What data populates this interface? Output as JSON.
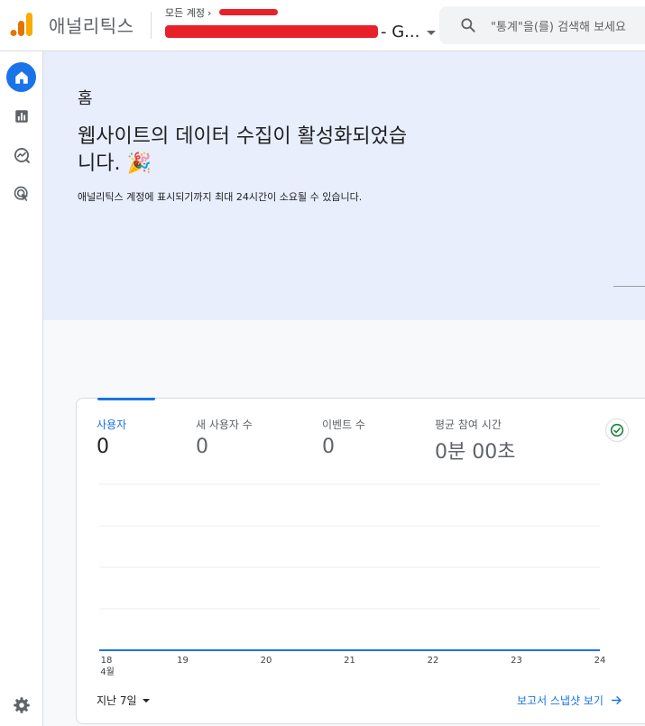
{
  "header": {
    "app_title": "애널리틱스",
    "breadcrumb_label": "모든 계정",
    "property_suffix": "- G...",
    "search_placeholder": "\"통계\"을(를) 검색해 보세요"
  },
  "rail": {
    "items": [
      {
        "name": "home",
        "icon": "home-icon",
        "active": true
      },
      {
        "name": "reports",
        "icon": "bar-chart-icon",
        "active": false
      },
      {
        "name": "explore",
        "icon": "explore-icon",
        "active": false
      },
      {
        "name": "advertising",
        "icon": "advertising-icon",
        "active": false
      }
    ],
    "settings_icon": "gear-icon"
  },
  "main": {
    "page_title": "홈",
    "headline": "웹사이트의 데이터 수집이 활성화되었습니다. 🎉",
    "subline": "애널리틱스 계정에 표시되기까지 최대 24시간이 소요될 수 있습니다."
  },
  "card": {
    "metrics": [
      {
        "label": "사용자",
        "value": "0",
        "active": true
      },
      {
        "label": "새 사용자 수",
        "value": "0",
        "active": false
      },
      {
        "label": "이벤트 수",
        "value": "0",
        "active": false
      },
      {
        "label": "평균 참여 시간",
        "value": "0분 00초",
        "active": false
      }
    ],
    "status_icon": "check-circle-icon",
    "date_range": "지난 7일",
    "snapshot_link": "보고서 스냅샷 보기"
  },
  "chart_data": {
    "type": "line",
    "x": [
      "18",
      "19",
      "20",
      "21",
      "22",
      "23",
      "24"
    ],
    "x_sublabel": "4월",
    "series": [
      {
        "values": [
          0,
          0,
          0,
          0,
          0,
          0,
          0
        ]
      }
    ],
    "grid": true
  },
  "colors": {
    "accent": "#1a73e8",
    "hero_bg": "#e8eefb",
    "success": "#188038",
    "logo_orange": "#f9ab00",
    "logo_dark": "#e37400"
  }
}
